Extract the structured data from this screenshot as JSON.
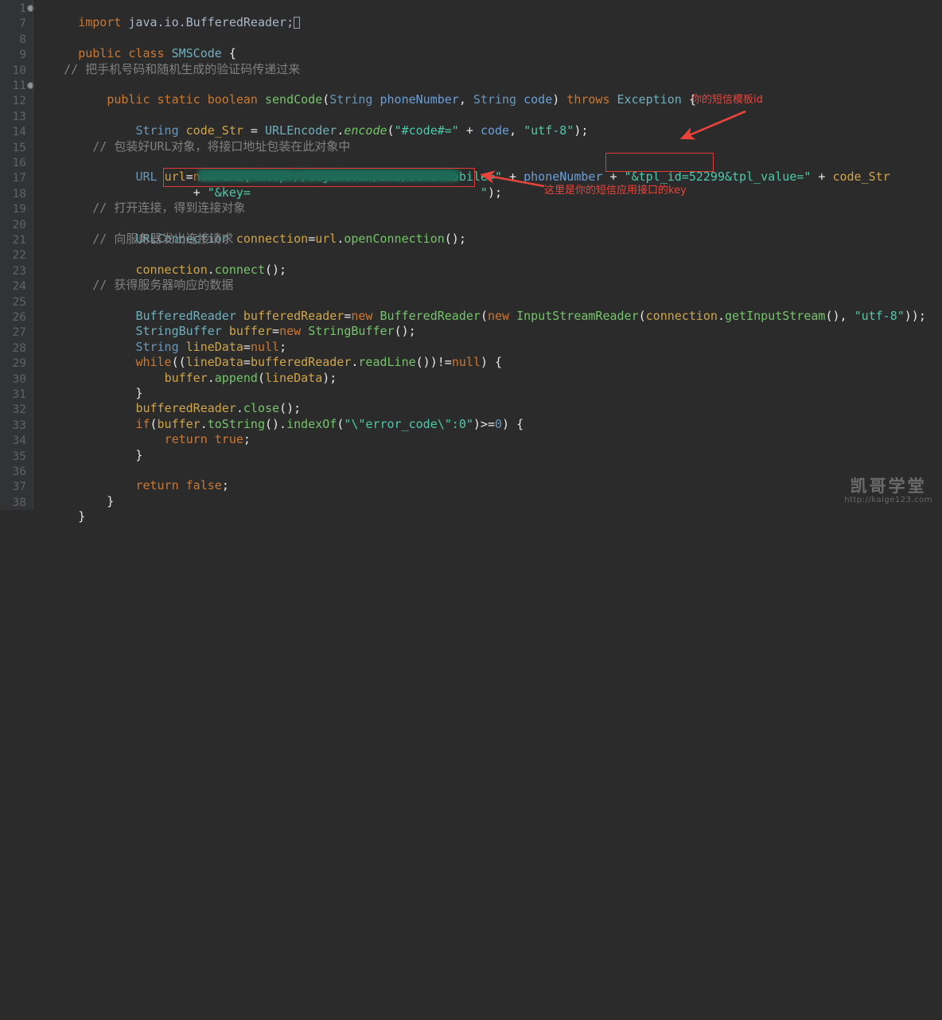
{
  "editor": {
    "theme_background": "#2b2b2b",
    "gutter_background": "#313335",
    "caret_symbol": "caret",
    "line_numbers": [
      "1",
      "7",
      "8",
      "9",
      "10",
      "11",
      "12",
      "13",
      "14",
      "15",
      "16",
      "17",
      "18",
      "19",
      "20",
      "21",
      "22",
      "23",
      "24",
      "25",
      "26",
      "27",
      "28",
      "29",
      "30",
      "31",
      "32",
      "33",
      "34",
      "35",
      "36",
      "37",
      "38"
    ],
    "fold_markers_on_lines": [
      "1",
      "11"
    ]
  },
  "code_lines": [
    {
      "num": "1",
      "text": "import java.io.BufferedReader;"
    },
    {
      "num": "7",
      "text": ""
    },
    {
      "num": "8",
      "text": "public class SMSCode {"
    },
    {
      "num": "9",
      "text": ""
    },
    {
      "num": "10",
      "text": "    // 把手机号码和随机生成的验证码传递过来"
    },
    {
      "num": "11",
      "text": "    public static boolean sendCode(String phoneNumber, String code) throws Exception {"
    },
    {
      "num": "12",
      "text": ""
    },
    {
      "num": "13",
      "text": "        String code_Str = URLEncoder.encode(\"#code#=\" + code, \"utf-8\");"
    },
    {
      "num": "14",
      "text": ""
    },
    {
      "num": "15",
      "text": "        // 包装好URL对象，将接口地址包装在此对象中"
    },
    {
      "num": "16",
      "text": "        URL url=new URL(\"http://v.juhe.cn/sms/send?mobile=\" + phoneNumber + \"&tpl_id=52299&tpl_value=\" + code_Str"
    },
    {
      "num": "17",
      "text": "                + \"&key=████████████████████████████████\");"
    },
    {
      "num": "18",
      "text": ""
    },
    {
      "num": "19",
      "text": "        // 打开连接，得到连接对象"
    },
    {
      "num": "20",
      "text": "        URLConnection connection=url.openConnection();"
    },
    {
      "num": "21",
      "text": "        // 向服务器发出连接请求"
    },
    {
      "num": "22",
      "text": "        connection.connect();"
    },
    {
      "num": "23",
      "text": ""
    },
    {
      "num": "24",
      "text": "        // 获得服务器响应的数据"
    },
    {
      "num": "25",
      "text": "        BufferedReader bufferedReader=new BufferedReader(new InputStreamReader(connection.getInputStream(), \"utf-8\"));"
    },
    {
      "num": "26",
      "text": "        StringBuffer buffer=new StringBuffer();"
    },
    {
      "num": "27",
      "text": "        String lineData=null;"
    },
    {
      "num": "28",
      "text": "        while((lineData=bufferedReader.readLine())!=null) {"
    },
    {
      "num": "29",
      "text": "            buffer.append(lineData);"
    },
    {
      "num": "30",
      "text": "        }"
    },
    {
      "num": "31",
      "text": "        bufferedReader.close();"
    },
    {
      "num": "32",
      "text": "        if(buffer.toString().indexOf(\"\\\"error_code\\\":0\")>=0) {"
    },
    {
      "num": "33",
      "text": "            return true;"
    },
    {
      "num": "34",
      "text": "        }"
    },
    {
      "num": "35",
      "text": ""
    },
    {
      "num": "36",
      "text": "        return false;"
    },
    {
      "num": "37",
      "text": "    }"
    },
    {
      "num": "38",
      "text": "}"
    }
  ],
  "annotations": {
    "color": "#e8443c",
    "template_id_note": "你的短信模板id",
    "key_note": "这里是你的短信应用接口的key",
    "highlighted_template_id_literal": "\"&tpl_id=52299&tpl_value=\"",
    "highlighted_key_literal": "\"&key=\");",
    "redacted_key_placeholder": "",
    "template_id_value": "52299"
  },
  "watermark": {
    "title": "凯哥学堂",
    "url": "http://kaige123.com"
  },
  "tokens": {
    "l1": {
      "kw": "import",
      "rest": " java.io.BufferedReader;"
    },
    "l8": {
      "kw_public": "public",
      "kw_class": "class",
      "name": "SMSCode",
      "brace": "{"
    },
    "l10": {
      "comment": "// 把手机号码和随机生成的验证码传递过来"
    },
    "l11": {
      "public": "public",
      "static": "static",
      "boolean": "boolean",
      "method": "sendCode",
      "p1type": "String",
      "p1": "phoneNumber",
      "p2type": "String",
      "p2": "code",
      "throws": "throws",
      "exc": "Exception"
    },
    "l13": {
      "type": "String",
      "var": "code_Str",
      "cls": "URLEncoder",
      "meth": "encode",
      "s1": "\"#code#=\"",
      "arg": "code",
      "s2": "\"utf-8\""
    },
    "l15": {
      "comment": "// 包装好URL对象，将接口地址包装在此对象中"
    },
    "l16": {
      "type": "URL",
      "var": "url",
      "new": "new",
      "cls": "URL",
      "s_url": "\"http://v.juhe.cn/sms/send?mobile=\"",
      "phone": "phoneNumber",
      "s_tpl": "\"&tpl_id=52299&tpl_value=\"",
      "codestr": "code_Str"
    },
    "l17": {
      "s_key_open": "\"&key=",
      "s_key_close": "\");"
    },
    "l19": {
      "comment": "// 打开连接，得到连接对象"
    },
    "l20": {
      "type": "URLConnection",
      "var": "connection",
      "obj": "url",
      "meth": "openConnection"
    },
    "l21": {
      "comment": "// 向服务器发出连接请求"
    },
    "l22": {
      "obj": "connection",
      "meth": "connect"
    },
    "l24": {
      "comment": "// 获得服务器响应的数据"
    },
    "l25": {
      "type": "BufferedReader",
      "var": "bufferedReader",
      "new": "new",
      "cls": "BufferedReader",
      "new2": "new",
      "cls2": "InputStreamReader",
      "obj": "connection",
      "meth": "getInputStream",
      "charset": "\"utf-8\""
    },
    "l26": {
      "type": "StringBuffer",
      "var": "buffer",
      "new": "new",
      "cls": "StringBuffer"
    },
    "l27": {
      "type": "String",
      "var": "lineData",
      "null": "null"
    },
    "l28": {
      "while": "while",
      "var": "lineData",
      "obj": "bufferedReader",
      "meth": "readLine",
      "null": "null"
    },
    "l29": {
      "obj": "buffer",
      "meth": "append",
      "arg": "lineData"
    },
    "l31": {
      "obj": "bufferedReader",
      "meth": "close"
    },
    "l32": {
      "if": "if",
      "obj": "buffer",
      "meth1": "toString",
      "meth2": "indexOf",
      "str": "\"\\\"error_code\\\":0\"",
      "num": "0"
    },
    "l33": {
      "return": "return",
      "val": "true"
    },
    "l36": {
      "return": "return",
      "val": "false"
    }
  }
}
